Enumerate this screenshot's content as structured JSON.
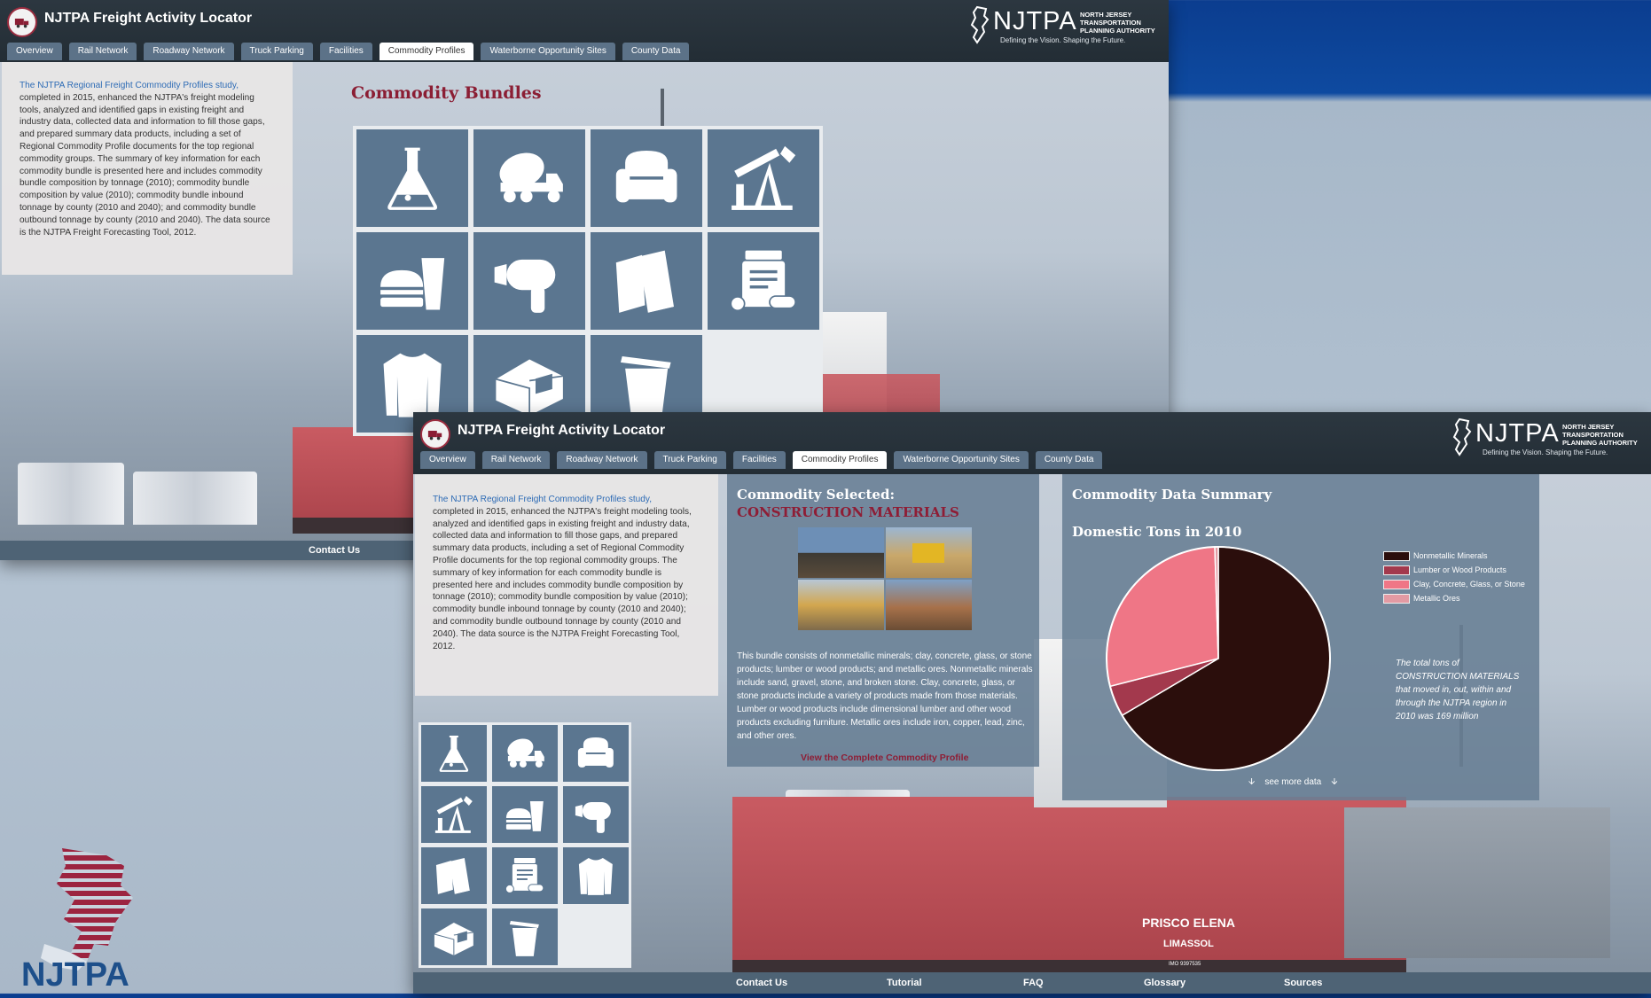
{
  "app": {
    "title": "NJTPA Freight Activity Locator",
    "brand_big": "NJTPA",
    "brand_small": [
      "NORTH JERSEY",
      "TRANSPORTATION",
      "PLANNING AUTHORITY"
    ],
    "brand_tagline": "Defining the Vision. Shaping the Future."
  },
  "tabs": [
    {
      "label": "Overview"
    },
    {
      "label": "Rail Network"
    },
    {
      "label": "Roadway Network"
    },
    {
      "label": "Truck Parking"
    },
    {
      "label": "Facilities"
    },
    {
      "label": "Commodity Profiles",
      "active": true
    },
    {
      "label": "Waterborne Opportunity Sites"
    },
    {
      "label": "County Data"
    }
  ],
  "intro": {
    "link_text": "The NJTPA Regional Freight Commodity Profiles study,",
    "body": "completed in 2015, enhanced the NJTPA's freight modeling tools, analyzed and identified gaps in existing freight and industry data, collected data and information to fill those gaps, and prepared summary data products, including a set of Regional Commodity Profile documents for the top regional commodity groups. The summary of key information for each commodity bundle is presented here and includes commodity bundle composition by tonnage (2010); commodity bundle composition by value (2010); commodity bundle inbound tonnage by county (2010 and 2040); and commodity bundle outbound tonnage by county (2010 and 2040). The data source is the NJTPA Freight Forecasting Tool, 2012."
  },
  "bundles_title": "Commodity Bundles",
  "bundle_icons": [
    "flask-icon",
    "cement-truck-icon",
    "armchair-icon",
    "oil-pump-icon",
    "burger-drink-icon",
    "hair-dryer-icon",
    "books-icon",
    "medicine-icon",
    "shirt-icon",
    "warehouse-icon",
    "trash-can-icon"
  ],
  "footer1": {
    "contact": "Contact Us"
  },
  "selected": {
    "heading": "Commodity Selected:",
    "name": "CONSTRUCTION MATERIALS",
    "description": "This bundle consists of nonmetallic minerals; clay, concrete, glass, or stone products; lumber or wood products; and metallic ores. Nonmetallic minerals include sand, gravel, stone, and broken stone. Clay, concrete, glass, or stone products include a variety of products made from those materials. Lumber or wood products include dimensional lumber and other wood products excluding furniture. Metallic ores include iron, copper, lead, zinc, and other ores.",
    "link": "View the Complete Commodity Profile"
  },
  "summary": {
    "heading": "Commodity Data Summary",
    "subheading": "Domestic Tons in 2010",
    "note": "The total tons of CONSTRUCTION MATERIALS that moved in, out, within and through the NJTPA region in 2010 was 169 million",
    "see_more": "see more data"
  },
  "chart_data": {
    "type": "pie",
    "title": "Domestic Tons in 2010",
    "legend_position": "right",
    "labels": [
      "Nonmetallic Minerals",
      "Lumber or Wood Products",
      "Clay, Concrete, Glass, or Stone",
      "Metallic Ores"
    ],
    "values": [
      66.5,
      4.5,
      28.5,
      0.5
    ],
    "colors": [
      "#2b0e0c",
      "#a3394d",
      "#ef7686",
      "#e39aa3"
    ]
  },
  "footer2": [
    "Contact Us",
    "Tutorial",
    "FAQ",
    "Glossary",
    "Sources"
  ],
  "ship": {
    "name": "PRISCO ELENA",
    "port": "LIMASSOL",
    "imo": "IMO 9397535"
  },
  "corner_logo_text": "NJTPA"
}
